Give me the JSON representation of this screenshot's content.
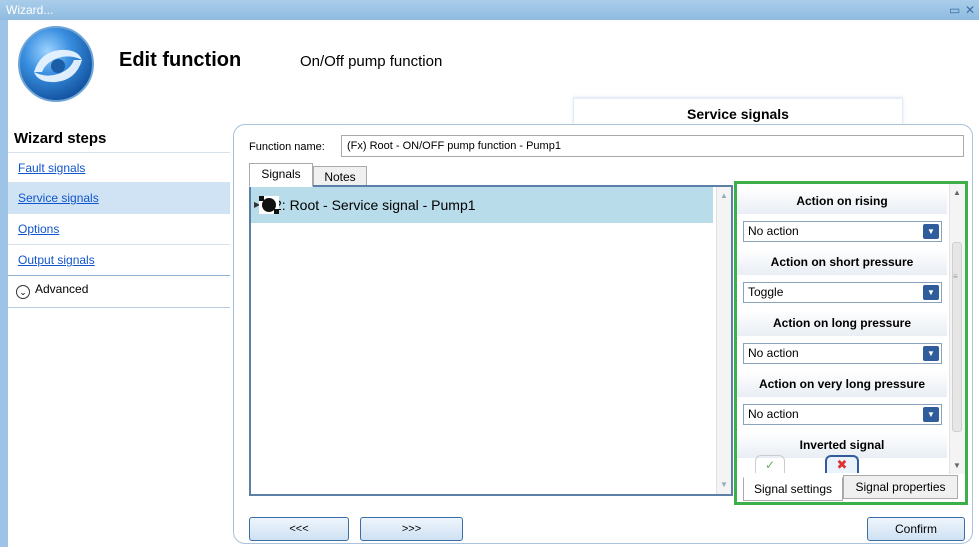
{
  "window": {
    "title": "Wizard..."
  },
  "header": {
    "title": "Edit function",
    "subtitle": "On/Off pump function",
    "current_step": "Service signals"
  },
  "wizard_steps": {
    "title": "Wizard steps",
    "items": [
      {
        "label": "Fault signals",
        "selected": false
      },
      {
        "label": "Service signals",
        "selected": true
      },
      {
        "label": "Options",
        "selected": false
      },
      {
        "label": "Output signals",
        "selected": false
      }
    ],
    "advanced_label": "Advanced"
  },
  "function_name": {
    "label": "Function name:",
    "value": "(Fx) Root - ON/OFF pump function - Pump1"
  },
  "tabs": [
    {
      "label": "Signals",
      "active": true
    },
    {
      "label": "Notes",
      "active": false
    }
  ],
  "signals": [
    {
      "label": "2: Root - Service signal - Pump1",
      "icon": "push-button-icon",
      "selected": true
    }
  ],
  "signal_settings": {
    "sections": [
      {
        "heading": "Action on rising",
        "value": "No action"
      },
      {
        "heading": "Action on short pressure",
        "value": "Toggle"
      },
      {
        "heading": "Action on long pressure",
        "value": "No action"
      },
      {
        "heading": "Action on very long pressure",
        "value": "No action"
      }
    ],
    "inverted_heading": "Inverted signal",
    "inverted_selected": "no",
    "tabs": [
      {
        "label": "Signal settings",
        "active": true
      },
      {
        "label": "Signal properties",
        "active": false
      }
    ]
  },
  "buttons": {
    "prev": "<<<",
    "next": ">>>",
    "confirm": "Confirm"
  },
  "colors": {
    "highlight_border": "#3cae4a",
    "selected_row": "#b8dcea",
    "titlebar": "#9dc3e6"
  }
}
